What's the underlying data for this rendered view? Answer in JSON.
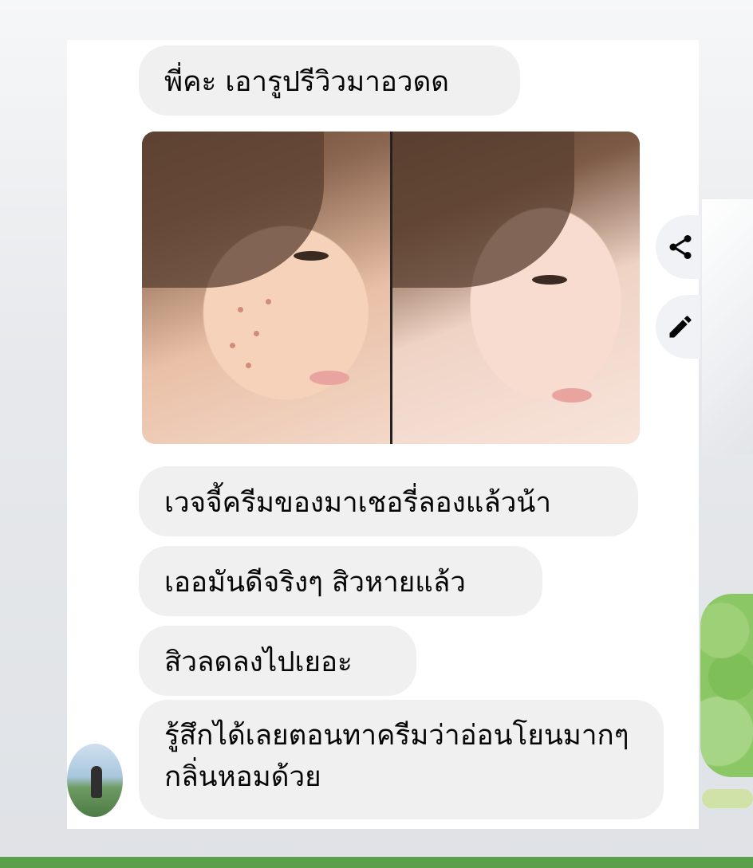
{
  "messages": [
    {
      "text": "พี่คะ เอารูปรีวิวมาอวดด"
    },
    {
      "text": "เวจจี้ครีมของมาเชอรี่ลองแล้วน้า"
    },
    {
      "text": "เออมันดีจริงๆ สิวหายแล้ว"
    },
    {
      "text": "สิวลดลงไปเยอะ"
    },
    {
      "text": "รู้สึกได้เลยตอนทาครีมว่าอ่อนโยนมากๆกลิ่นหอมด้วย"
    }
  ],
  "photos": [
    "before-face-photo",
    "after-face-photo"
  ],
  "actions": {
    "share_icon": "share-icon",
    "edit_icon": "pencil-icon"
  },
  "colors": {
    "bubble": "#f0f0f0",
    "text": "#050505",
    "accent_strip": "#5aa04a"
  }
}
